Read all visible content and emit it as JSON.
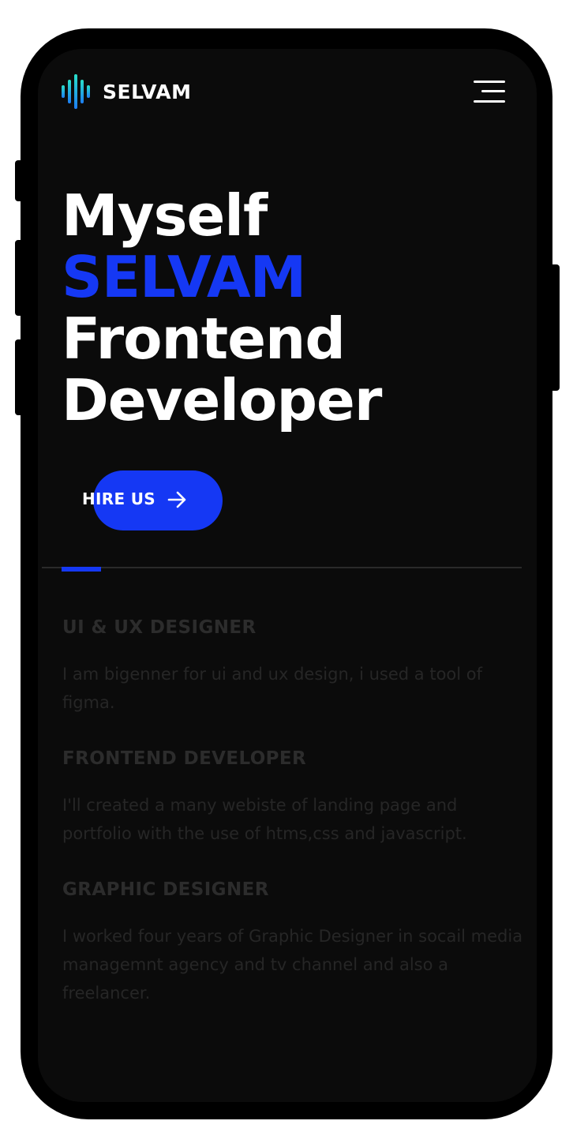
{
  "header": {
    "brand": "SELVAM",
    "logo_icon": "sound-wave-icon",
    "menu_icon": "hamburger-menu-icon"
  },
  "hero": {
    "line1": "Myself",
    "line2": "SELVAM",
    "line3": "Frontend",
    "line4": "Developer",
    "cta_label": "HIRE US",
    "cta_icon": "arrow-right-icon"
  },
  "services": [
    {
      "title": "UI & UX DESIGNER",
      "description": "I am bigenner for ui and ux design, i used a tool of figma."
    },
    {
      "title": "FRONTEND DEVELOPER",
      "description": "I'll created a many webiste of landing page and portfolio with the use of htms,css and javascript."
    },
    {
      "title": "GRAPHIC DESIGNER",
      "description": "I worked four years of Graphic Designer in socail media managemnt agency and tv channel and also a freelancer."
    }
  ],
  "colors": {
    "accent": "#1538f4",
    "background": "#0b0b0b",
    "logo_gradient_top": "#29e0c9",
    "logo_gradient_bottom": "#1d7cf2",
    "muted_text": "#2c2c2c"
  }
}
